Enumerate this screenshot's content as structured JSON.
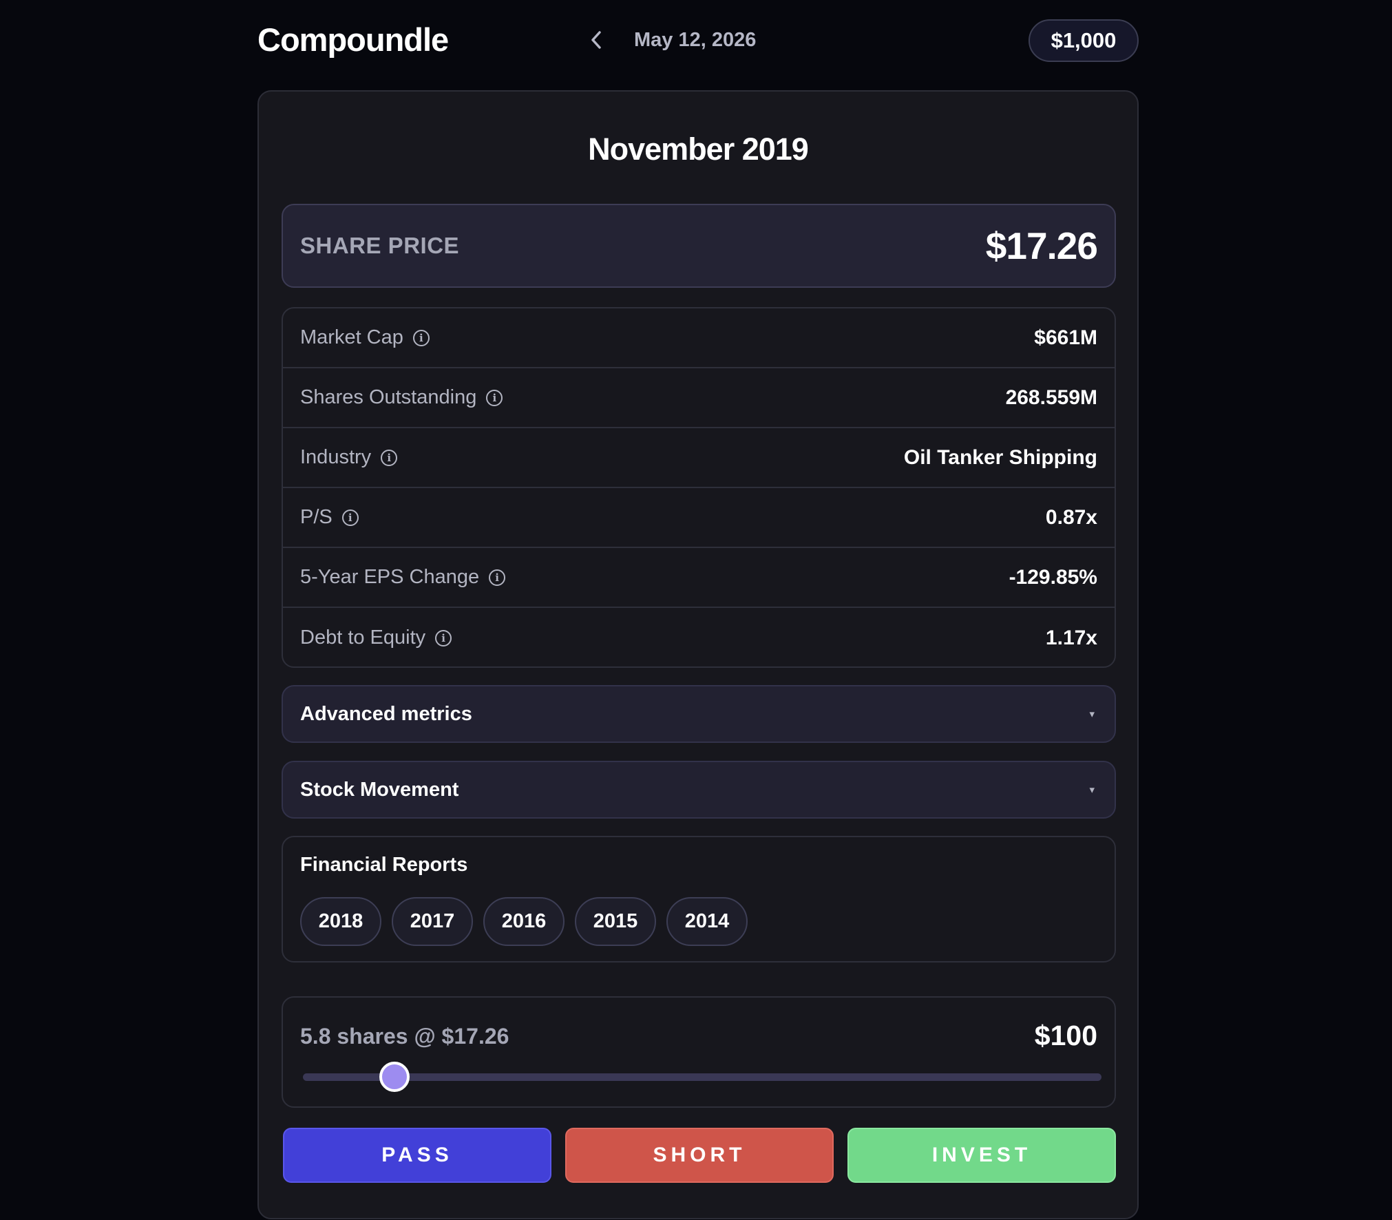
{
  "header": {
    "brand": "Compoundle",
    "back_icon": "chevron-left-icon",
    "date": "May 12, 2026",
    "balance": "$1,000"
  },
  "card": {
    "title": "November 2019",
    "share_price": {
      "label": "SHARE PRICE",
      "value": "$17.26"
    },
    "metrics": [
      {
        "label": "Market Cap",
        "value": "$661M",
        "icon": "info-icon"
      },
      {
        "label": "Shares Outstanding",
        "value": "268.559M",
        "icon": "info-icon"
      },
      {
        "label": "Industry",
        "value": "Oil Tanker Shipping",
        "icon": "info-icon"
      },
      {
        "label": "P/S",
        "value": "0.87x",
        "icon": "info-icon"
      },
      {
        "label": "5-Year EPS Change",
        "value": "-129.85%",
        "icon": "info-icon"
      },
      {
        "label": "Debt to Equity",
        "value": "1.17x",
        "icon": "info-icon"
      }
    ],
    "accordions": [
      {
        "title": "Advanced metrics",
        "arrow": "▾"
      },
      {
        "title": "Stock Movement",
        "arrow": "▾"
      }
    ],
    "financial_reports": {
      "title": "Financial Reports",
      "years": [
        "2018",
        "2017",
        "2016",
        "2015",
        "2014"
      ]
    },
    "trade": {
      "label": "5.8 shares @ $17.26",
      "amount": "$100",
      "slider_fraction": 0.115
    },
    "actions": {
      "pass": "PASS",
      "short": "SHORT",
      "invest": "INVEST"
    }
  },
  "colors": {
    "background": "#06070d",
    "card": "#17171d",
    "pass": "#4240d8",
    "short": "#cf554a",
    "invest": "#72d98a",
    "slider_thumb": "#9d8cf0"
  }
}
